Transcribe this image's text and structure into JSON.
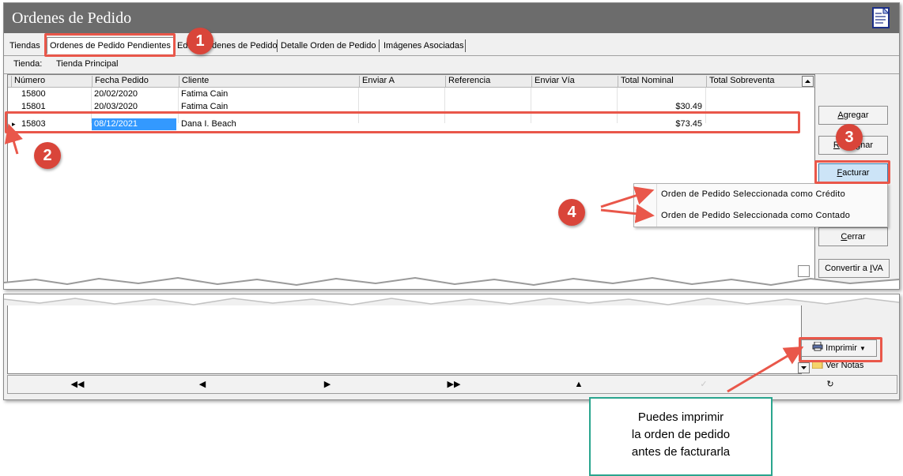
{
  "window": {
    "title": "Ordenes de Pedido"
  },
  "tabs": [
    {
      "label": "Tiendas"
    },
    {
      "label": "Ordenes de Pedido Pendientes"
    },
    {
      "label": "Editar Ordenes de Pedido"
    },
    {
      "label": "Detalle Orden de Pedido"
    },
    {
      "label": "Imágenes Asociadas"
    }
  ],
  "store": {
    "label": "Tienda:",
    "value": "Tienda Principal"
  },
  "table": {
    "columns": [
      "Número",
      "Fecha Pedido",
      "Cliente",
      "Enviar A",
      "Referencia",
      "Enviar Vía",
      "Total Nominal",
      "Total Sobreventa"
    ],
    "rows": [
      {
        "numero": "15800",
        "fecha": "20/02/2020",
        "cliente": "Fatima Cain",
        "total": ""
      },
      {
        "numero": "15801",
        "fecha": "20/03/2020",
        "cliente": "Fatima Cain",
        "total": "$30.49"
      },
      {
        "numero": "15803",
        "fecha": "08/12/2021",
        "cliente": "Dana I. Beach",
        "total": "$73.45"
      }
    ],
    "selected_row_marker": "▸"
  },
  "buttons": {
    "agregar": {
      "hot": "A",
      "rest": "gregar"
    },
    "reasignar": {
      "hot": "R",
      "rest": "easignar"
    },
    "facturar": {
      "hot": "F",
      "rest": "acturar"
    },
    "cerrar": {
      "hot": "C",
      "rest": "errar"
    },
    "convertir": {
      "pre": "Convertir a ",
      "hot": "I",
      "rest": "VA"
    },
    "imprimir": "Imprimir",
    "ver_notas": "Ver Notas"
  },
  "facturar_menu": [
    {
      "label": "Orden de Pedido Seleccionada como Crédito"
    },
    {
      "label": "Orden de Pedido Seleccionada como Contado"
    }
  ],
  "badges": [
    "1",
    "2",
    "3",
    "4"
  ],
  "callout": {
    "lines": [
      "Puedes imprimir",
      "la orden de pedido",
      "antes de facturarla"
    ]
  },
  "colors": {
    "accent_red": "#e9574a",
    "badge_red": "#d9453a",
    "callout_border": "#2aa58e",
    "selection": "#3399ff"
  }
}
